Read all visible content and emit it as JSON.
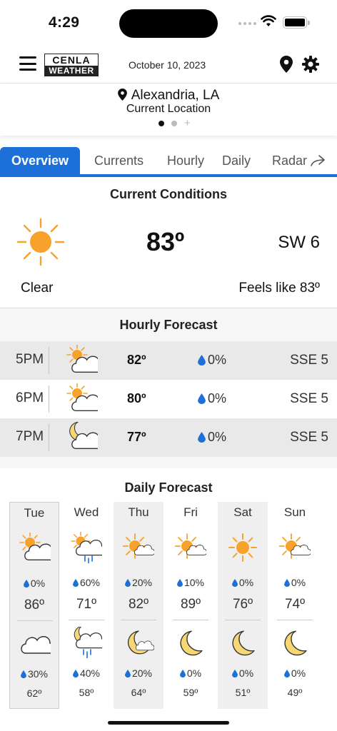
{
  "status_bar": {
    "time": "4:29"
  },
  "header": {
    "logo_top": "CENLA",
    "logo_bottom": "WEATHER",
    "date": "October 10, 2023"
  },
  "location": {
    "city": "Alexandria, LA",
    "subtitle": "Current Location",
    "plus": "+"
  },
  "tabs": [
    {
      "label": "Overview",
      "active": true
    },
    {
      "label": "Currents"
    },
    {
      "label": "Hourly"
    },
    {
      "label": "Daily"
    },
    {
      "label": "Radar"
    }
  ],
  "current": {
    "heading": "Current Conditions",
    "temp": "83º",
    "wind": "SW 6",
    "condition": "Clear",
    "feels_like": "Feels like 83º",
    "icon": "sun-icon"
  },
  "hourly": {
    "heading": "Hourly Forecast",
    "rows": [
      {
        "time": "5PM",
        "icon": "partly-cloudy-day-icon",
        "temp": "82º",
        "precip": "0%",
        "wind": "SSE 5"
      },
      {
        "time": "6PM",
        "icon": "partly-cloudy-day-icon",
        "temp": "80º",
        "precip": "0%",
        "wind": "SSE 5"
      },
      {
        "time": "7PM",
        "icon": "partly-cloudy-night-icon",
        "temp": "77º",
        "precip": "0%",
        "wind": "SSE 5"
      }
    ]
  },
  "daily": {
    "heading": "Daily Forecast",
    "days": [
      {
        "day": "Tue",
        "day_icon": "partly-cloudy-day-icon",
        "day_precip": "0%",
        "high": "86º",
        "night_icon": "cloudy-icon",
        "night_precip": "30%",
        "low": "62º"
      },
      {
        "day": "Wed",
        "day_icon": "partly-cloudy-rain-icon",
        "day_precip": "60%",
        "high": "71º",
        "night_icon": "night-rain-icon",
        "night_precip": "40%",
        "low": "58º"
      },
      {
        "day": "Thu",
        "day_icon": "partly-sunny-icon",
        "day_precip": "20%",
        "high": "82º",
        "night_icon": "moon-cloud-icon",
        "night_precip": "20%",
        "low": "64º"
      },
      {
        "day": "Fri",
        "day_icon": "partly-sunny-icon",
        "day_precip": "10%",
        "high": "89º",
        "night_icon": "moon-icon",
        "night_precip": "0%",
        "low": "59º"
      },
      {
        "day": "Sat",
        "day_icon": "sun-icon",
        "day_precip": "0%",
        "high": "76º",
        "night_icon": "moon-icon",
        "night_precip": "0%",
        "low": "51º"
      },
      {
        "day": "Sun",
        "day_icon": "partly-sunny-icon",
        "day_precip": "0%",
        "high": "74º",
        "night_icon": "moon-icon",
        "night_precip": "0%",
        "low": "49º"
      }
    ]
  },
  "colors": {
    "accent": "#1d70d8",
    "sun": "#f7a22b",
    "moon": "#f7d774",
    "drop": "#1d70d8"
  }
}
